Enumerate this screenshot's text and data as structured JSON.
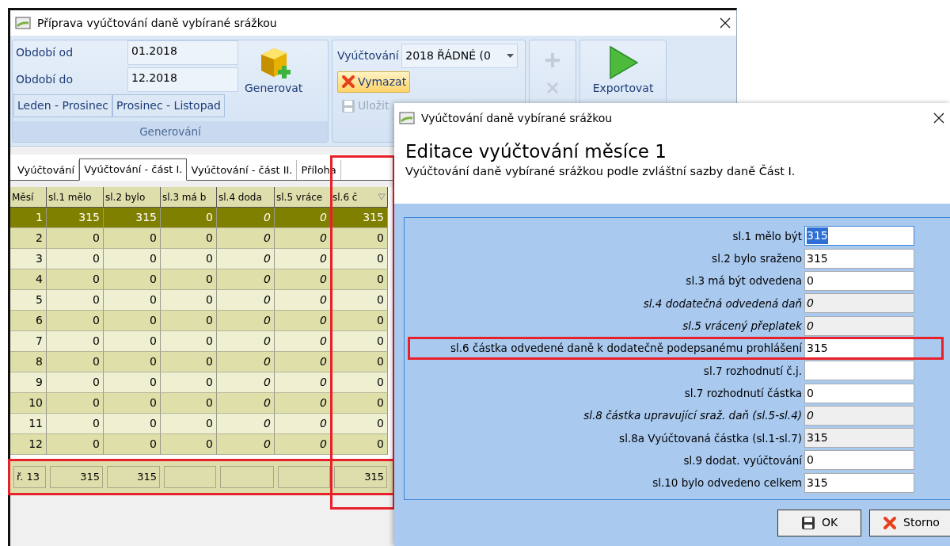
{
  "main_window": {
    "title": "Příprava vyúčtování daně vybírané srážkou"
  },
  "ribbon": {
    "fields": [
      {
        "label": "Období od",
        "value": "01.2018"
      },
      {
        "label": "Období do",
        "value": "12.2018"
      }
    ],
    "range_buttons": [
      "Leden - Prosinec",
      "Prosinec - Listopad"
    ],
    "generate_button": "Generovat",
    "group_label": "Generování",
    "statement_label": "Vyúčtování",
    "statement_value": "2018 ŘÁDNÉ (0",
    "delete_button": {
      "label": "Vymazat",
      "highlighted": true
    },
    "save_button": {
      "label": "Uložit",
      "disabled": true
    },
    "add_disabled": true,
    "export_button": "Exportovat"
  },
  "tabs": [
    {
      "label": "Vyúčtování",
      "selected": false
    },
    {
      "label": "Vyúčtování - část I.",
      "selected": true
    },
    {
      "label": "Vyúčtování - část II.",
      "selected": false
    },
    {
      "label": "Příloha",
      "selected": false
    }
  ],
  "table": {
    "columns": [
      {
        "label": "Měsí",
        "italic": false,
        "filter": false,
        "highlighted": false
      },
      {
        "label": "sl.1 mělo",
        "italic": false,
        "filter": false,
        "highlighted": false
      },
      {
        "label": "sl.2 bylo",
        "italic": false,
        "filter": false,
        "highlighted": false
      },
      {
        "label": "sl.3 má b",
        "italic": false,
        "filter": false,
        "highlighted": false
      },
      {
        "label": "sl.4 doda",
        "italic": true,
        "filter": false,
        "highlighted": false
      },
      {
        "label": "sl.5 vráce",
        "italic": true,
        "filter": false,
        "highlighted": false
      },
      {
        "label": "sl.6 č",
        "italic": false,
        "filter": true,
        "highlighted": true
      }
    ],
    "rows": [
      {
        "selected": true,
        "cells": [
          "1",
          "315",
          "315",
          "0",
          "0",
          "0",
          "315"
        ]
      },
      {
        "selected": false,
        "cells": [
          "2",
          "0",
          "0",
          "0",
          "0",
          "0",
          "0"
        ]
      },
      {
        "selected": false,
        "cells": [
          "3",
          "0",
          "0",
          "0",
          "0",
          "0",
          "0"
        ]
      },
      {
        "selected": false,
        "cells": [
          "4",
          "0",
          "0",
          "0",
          "0",
          "0",
          "0"
        ]
      },
      {
        "selected": false,
        "cells": [
          "5",
          "0",
          "0",
          "0",
          "0",
          "0",
          "0"
        ]
      },
      {
        "selected": false,
        "cells": [
          "6",
          "0",
          "0",
          "0",
          "0",
          "0",
          "0"
        ]
      },
      {
        "selected": false,
        "cells": [
          "7",
          "0",
          "0",
          "0",
          "0",
          "0",
          "0"
        ]
      },
      {
        "selected": false,
        "cells": [
          "8",
          "0",
          "0",
          "0",
          "0",
          "0",
          "0"
        ]
      },
      {
        "selected": false,
        "cells": [
          "9",
          "0",
          "0",
          "0",
          "0",
          "0",
          "0"
        ]
      },
      {
        "selected": false,
        "cells": [
          "10",
          "0",
          "0",
          "0",
          "0",
          "0",
          "0"
        ]
      },
      {
        "selected": false,
        "cells": [
          "11",
          "0",
          "0",
          "0",
          "0",
          "0",
          "0"
        ]
      },
      {
        "selected": false,
        "cells": [
          "12",
          "0",
          "0",
          "0",
          "0",
          "0",
          "0"
        ]
      }
    ],
    "footer": {
      "highlighted": true,
      "cells": [
        "ř. 13",
        "315",
        "315",
        "",
        "",
        "",
        "315"
      ]
    }
  },
  "dialog": {
    "title": "Vyúčtování daně vybírané srážkou",
    "heading": "Editace vyúčtování měsíce 1",
    "subtitle": "Vyúčtování daně vybírané srážkou podle zvláštní sazby daně Část I.",
    "fields": [
      {
        "label": "sl.1 mělo být",
        "value": "315",
        "readonly": false,
        "italic": false,
        "focused": true,
        "highlighted": false
      },
      {
        "label": "sl.2 bylo sraženo",
        "value": "315",
        "readonly": false,
        "italic": false,
        "focused": false,
        "highlighted": false
      },
      {
        "label": "sl.3 má být odvedena",
        "value": "0",
        "readonly": false,
        "italic": false,
        "focused": false,
        "highlighted": false
      },
      {
        "label": "sl.4 dodatečná odvedená daň",
        "value": "0",
        "readonly": true,
        "italic": true,
        "focused": false,
        "highlighted": false
      },
      {
        "label": "sl.5 vrácený přeplatek",
        "value": "0",
        "readonly": true,
        "italic": true,
        "focused": false,
        "highlighted": false
      },
      {
        "label": "sl.6 částka odvedené daně k dodatečně podepsanému prohlášení",
        "value": "315",
        "readonly": false,
        "italic": false,
        "focused": false,
        "highlighted": true
      },
      {
        "label": "sl.7 rozhodnutí č.j.",
        "readonly": false,
        "italic": false,
        "focused": false,
        "highlighted": false
      },
      {
        "label": "sl.7 rozhodnutí částka",
        "value": "0",
        "readonly": false,
        "italic": false,
        "focused": false,
        "highlighted": false
      },
      {
        "label": "sl.8 částka upravující sraž. daň (sl.5-sl.4)",
        "value": "0",
        "readonly": true,
        "italic": true,
        "focused": false,
        "highlighted": false
      },
      {
        "label": "sl.8a Vyúčtovaná částka (sl.1-sl.7)",
        "value": "315",
        "readonly": true,
        "italic": false,
        "focused": false,
        "highlighted": false
      },
      {
        "label": "sl.9 dodat. vyúčtování",
        "value": "0",
        "readonly": false,
        "italic": false,
        "focused": false,
        "highlighted": false
      },
      {
        "label": "sl.10 bylo odvedeno celkem",
        "value": "315",
        "readonly": false,
        "italic": false,
        "focused": false,
        "highlighted": false
      }
    ],
    "buttons": [
      {
        "label": "OK",
        "kind": "save"
      },
      {
        "label": "Storno",
        "kind": "cancel"
      }
    ]
  }
}
